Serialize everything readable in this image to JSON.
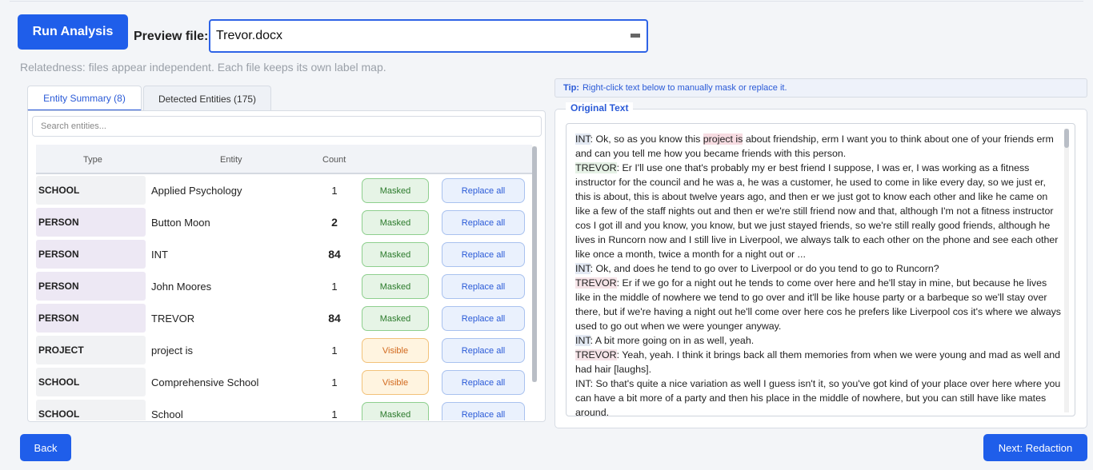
{
  "toolbar": {
    "run_label": "Run Analysis",
    "preview_label": "Preview file:",
    "file_value": "Trevor.docx"
  },
  "relatedness": "Relatedness: files appear independent. Each file keeps its own label map.",
  "tabs": {
    "summary": "Entity Summary (8)",
    "detected": "Detected Entities (175)"
  },
  "search": {
    "placeholder": "Search entities..."
  },
  "table": {
    "headers": {
      "type": "Type",
      "entity": "Entity",
      "count": "Count"
    },
    "rows": [
      {
        "type": "SCHOOL",
        "entity": "Applied Psychology",
        "count": "1",
        "status": "Masked",
        "action": "Replace all"
      },
      {
        "type": "PERSON",
        "entity": "Button Moon",
        "count": "2",
        "status": "Masked",
        "action": "Replace all"
      },
      {
        "type": "PERSON",
        "entity": "INT",
        "count": "84",
        "status": "Masked",
        "action": "Replace all"
      },
      {
        "type": "PERSON",
        "entity": "John Moores",
        "count": "1",
        "status": "Masked",
        "action": "Replace all"
      },
      {
        "type": "PERSON",
        "entity": "TREVOR",
        "count": "84",
        "status": "Masked",
        "action": "Replace all"
      },
      {
        "type": "PROJECT",
        "entity": "project is",
        "count": "1",
        "status": "Visible",
        "action": "Replace all"
      },
      {
        "type": "SCHOOL",
        "entity": "Comprehensive School",
        "count": "1",
        "status": "Visible",
        "action": "Replace all"
      },
      {
        "type": "SCHOOL",
        "entity": "School",
        "count": "1",
        "status": "Masked",
        "action": "Replace all"
      }
    ]
  },
  "tip": {
    "label": "Tip:",
    "text": "Right-click text below to manually mask or replace it."
  },
  "original_text": {
    "legend": "Original Text",
    "lines": [
      {
        "speaker": "INT",
        "pre": ": Ok, so as you know this ",
        "highlight": "project is",
        "post": " about friendship, erm I want you to think about one of your friends erm and can you tell me how you became friends with this person."
      },
      {
        "speaker": "TREVOR",
        "text": ": Er I'll use one that's probably my er best friend I suppose, I was er, I was working as a fitness instructor for the council and he was a, he was a customer, he used to come in like every day, so we just er, this is about, this is about twelve years ago, and then er we just got to know each other and like he came on like a few of the staff nights out and then er we're still friend now and that, although I'm not a fitness instructor cos I got ill and you know, you know, but we just stayed friends, so we're still really good friends, although he lives in Runcorn now and I still live in Liverpool, we always talk to each other on the phone and see each other like once a month, twice a month for a night out or ..."
      },
      {
        "speaker": "INT",
        "text": ": Ok, and does he tend to go over to Liverpool or do you tend to go to Runcorn?"
      },
      {
        "speaker": "TREVOR",
        "text": ": Er if we go for a night out he tends to come over here and he'll stay in mine, but because he lives like in the middle of nowhere we tend to go over and it'll be like house party or a barbeque so we'll stay over there, but if we're having a night out he'll come over here cos he prefers like Liverpool cos it's where we always used to go out when we were younger anyway."
      },
      {
        "speaker": "INT",
        "text": ": A bit more going on in  as well, yeah."
      },
      {
        "speaker": "TREVOR",
        "text": ": Yeah, yeah. I think it brings back all them memories from when we were young and mad as well and had hair [laughs]."
      },
      {
        "speaker": "INT",
        "text": ": So that's quite a nice variation as well I guess isn't it, so you've got kind of your place over here where you can have a bit more of a party and then his place in the middle of nowhere, but you can still have like mates around."
      }
    ]
  },
  "nav": {
    "back_label": "Back",
    "next_label": "Next: Redaction"
  }
}
